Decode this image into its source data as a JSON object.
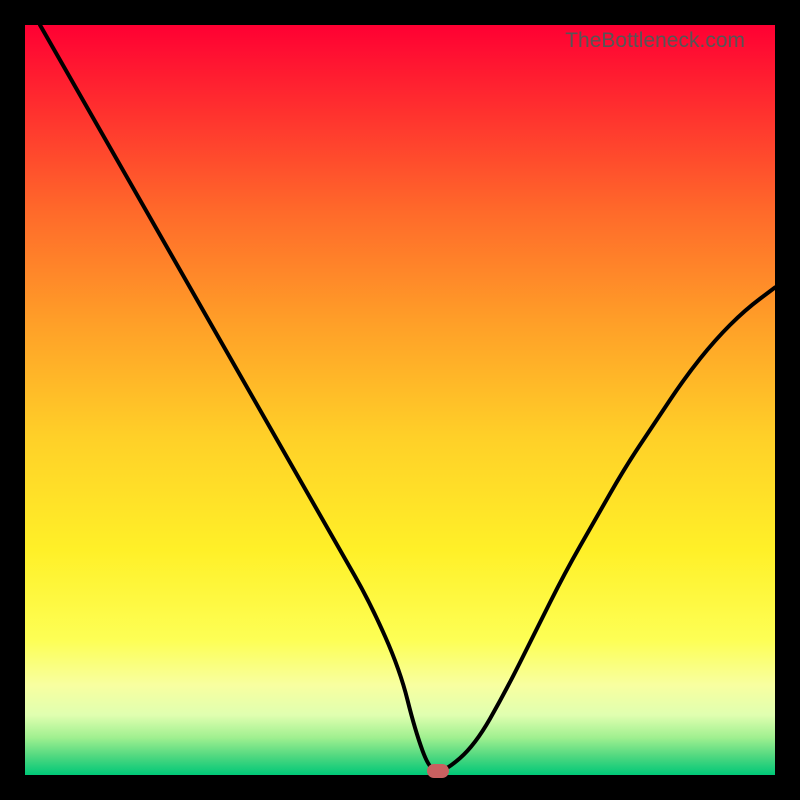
{
  "watermark": "TheBottleneck.com",
  "chart_data": {
    "type": "line",
    "title": "",
    "xlabel": "",
    "ylabel": "",
    "xlim": [
      0,
      100
    ],
    "ylim": [
      0,
      100
    ],
    "series": [
      {
        "name": "bottleneck-curve",
        "x": [
          2,
          6,
          10,
          14,
          18,
          22,
          26,
          30,
          34,
          38,
          42,
          46,
          50,
          52,
          54,
          56,
          60,
          64,
          68,
          72,
          76,
          80,
          84,
          88,
          92,
          96,
          100
        ],
        "y": [
          100,
          93,
          86,
          79,
          72,
          65,
          58,
          51,
          44,
          37,
          30,
          23,
          14,
          6,
          0.5,
          0.5,
          4,
          11,
          19,
          27,
          34,
          41,
          47,
          53,
          58,
          62,
          65
        ]
      }
    ],
    "marker": {
      "x": 55,
      "y": 0.5
    },
    "gradient_stops": [
      {
        "pos": 0.0,
        "color": "#ff0033"
      },
      {
        "pos": 0.1,
        "color": "#ff2a2f"
      },
      {
        "pos": 0.25,
        "color": "#ff6a2a"
      },
      {
        "pos": 0.4,
        "color": "#ffa028"
      },
      {
        "pos": 0.55,
        "color": "#ffd028"
      },
      {
        "pos": 0.7,
        "color": "#fff028"
      },
      {
        "pos": 0.82,
        "color": "#fdff55"
      },
      {
        "pos": 0.88,
        "color": "#f8ffa0"
      },
      {
        "pos": 0.92,
        "color": "#e0ffb0"
      },
      {
        "pos": 0.95,
        "color": "#a0f090"
      },
      {
        "pos": 0.975,
        "color": "#50d880"
      },
      {
        "pos": 1.0,
        "color": "#00c878"
      }
    ]
  }
}
